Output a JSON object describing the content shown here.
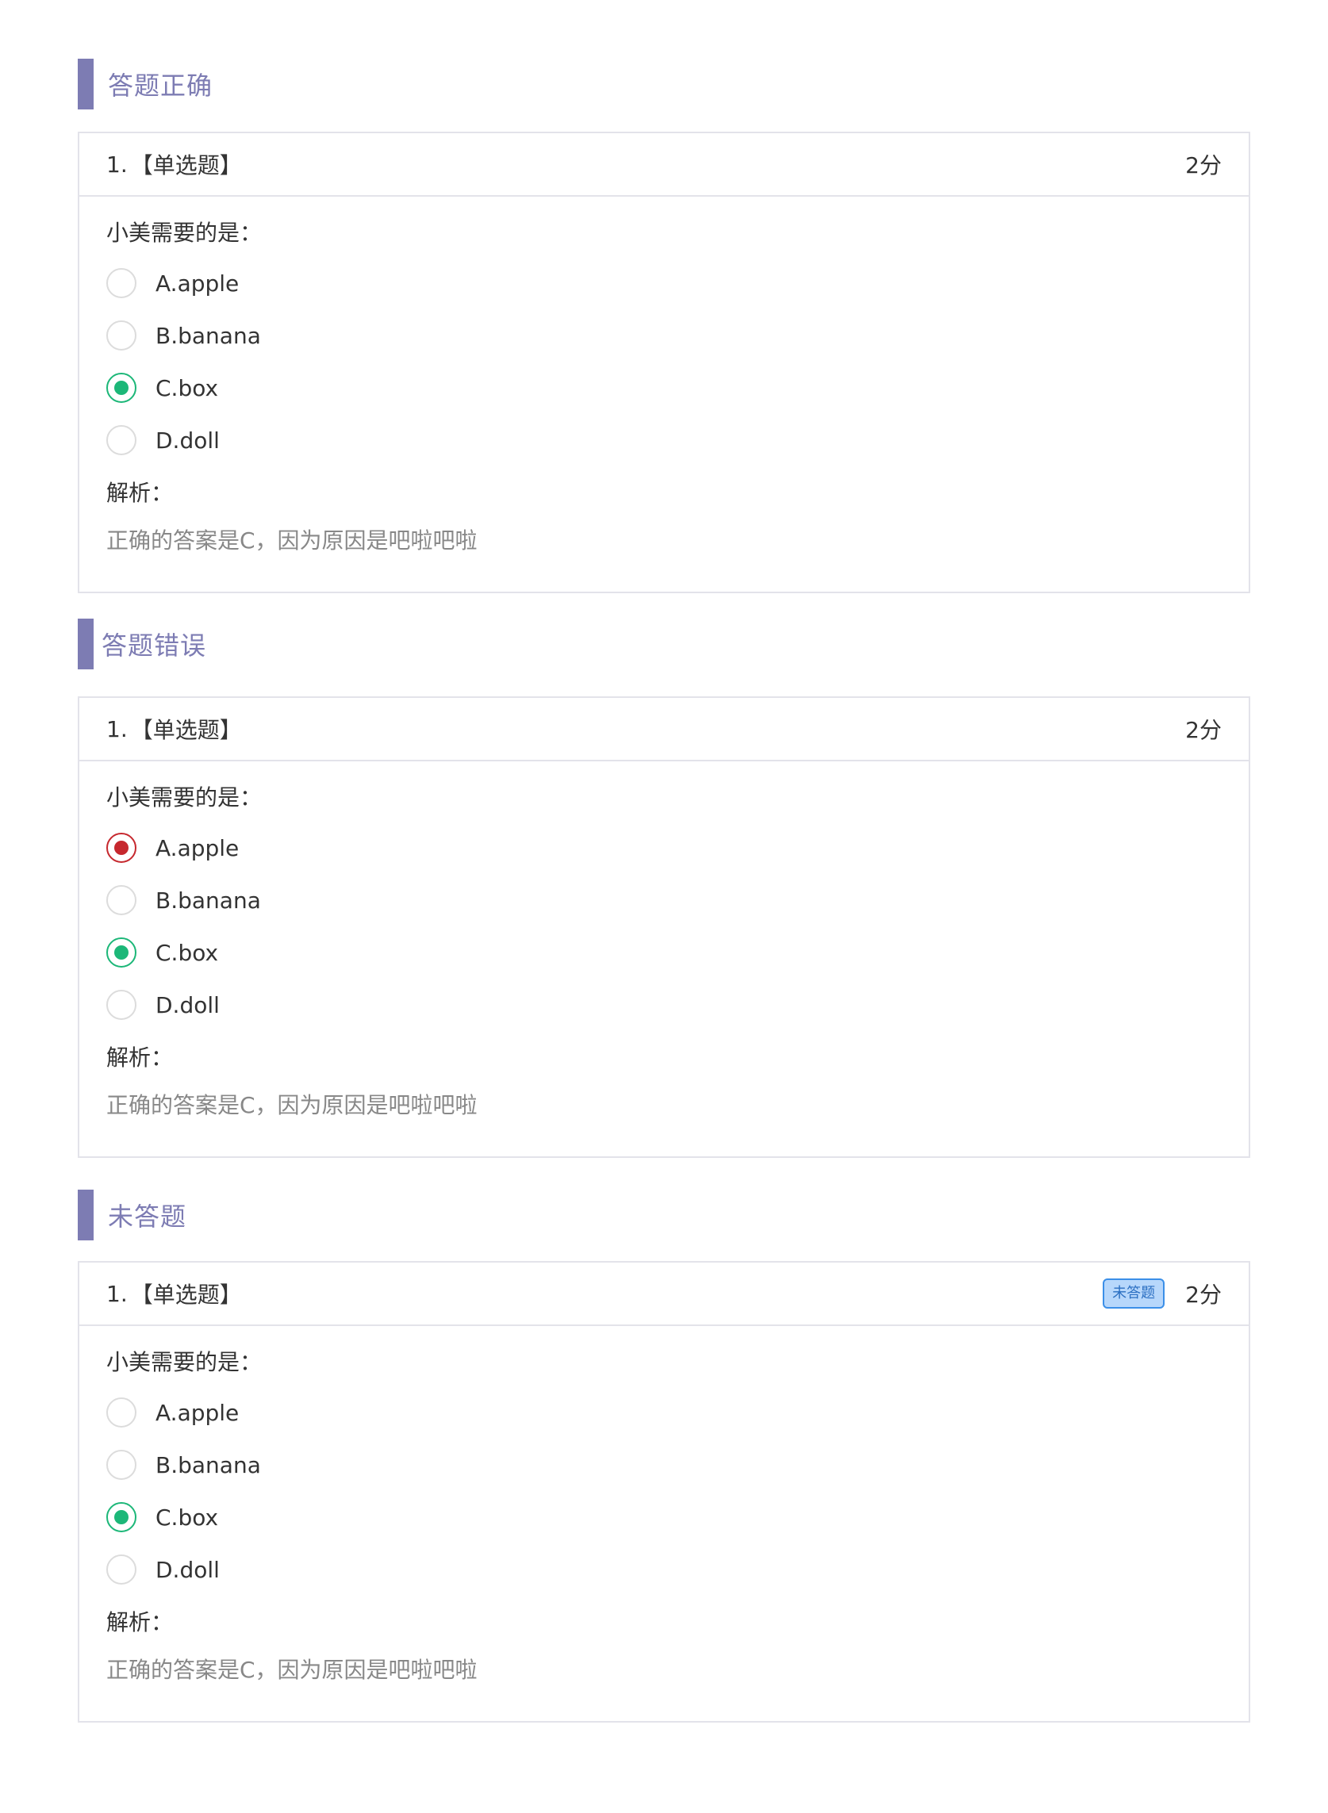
{
  "sections": [
    {
      "title": "答题正确",
      "question": {
        "number": "1.",
        "type": "【单选题】",
        "badge": "",
        "score": "2分",
        "stem": "小美需要的是：",
        "options": [
          {
            "label": "A.apple",
            "state": "none"
          },
          {
            "label": "B.banana",
            "state": "none"
          },
          {
            "label": "C.box",
            "state": "correct"
          },
          {
            "label": "D.doll",
            "state": "none"
          }
        ],
        "analysis_label": "解析：",
        "analysis_text": "正确的答案是C，因为原因是吧啦吧啦"
      }
    },
    {
      "title": "答题错误",
      "question": {
        "number": "1.",
        "type": "【单选题】",
        "badge": "",
        "score": "2分",
        "stem": "小美需要的是：",
        "options": [
          {
            "label": "A.apple",
            "state": "wrong"
          },
          {
            "label": "B.banana",
            "state": "none"
          },
          {
            "label": "C.box",
            "state": "correct"
          },
          {
            "label": "D.doll",
            "state": "none"
          }
        ],
        "analysis_label": "解析：",
        "analysis_text": "正确的答案是C，因为原因是吧啦吧啦"
      }
    },
    {
      "title": "未答题",
      "question": {
        "number": "1.",
        "type": "【单选题】",
        "badge": "未答题",
        "score": "2分",
        "stem": "小美需要的是：",
        "options": [
          {
            "label": "A.apple",
            "state": "none"
          },
          {
            "label": "B.banana",
            "state": "none"
          },
          {
            "label": "C.box",
            "state": "correct"
          },
          {
            "label": "D.doll",
            "state": "none"
          }
        ],
        "analysis_label": "解析：",
        "analysis_text": "正确的答案是C，因为原因是吧啦吧啦"
      }
    }
  ],
  "colors": {
    "section_accent": "#7d7cb3",
    "correct": "#1cb778",
    "wrong": "#c6282e",
    "badge_border": "#3b8fe8",
    "badge_fill": "#b7d7fb"
  }
}
